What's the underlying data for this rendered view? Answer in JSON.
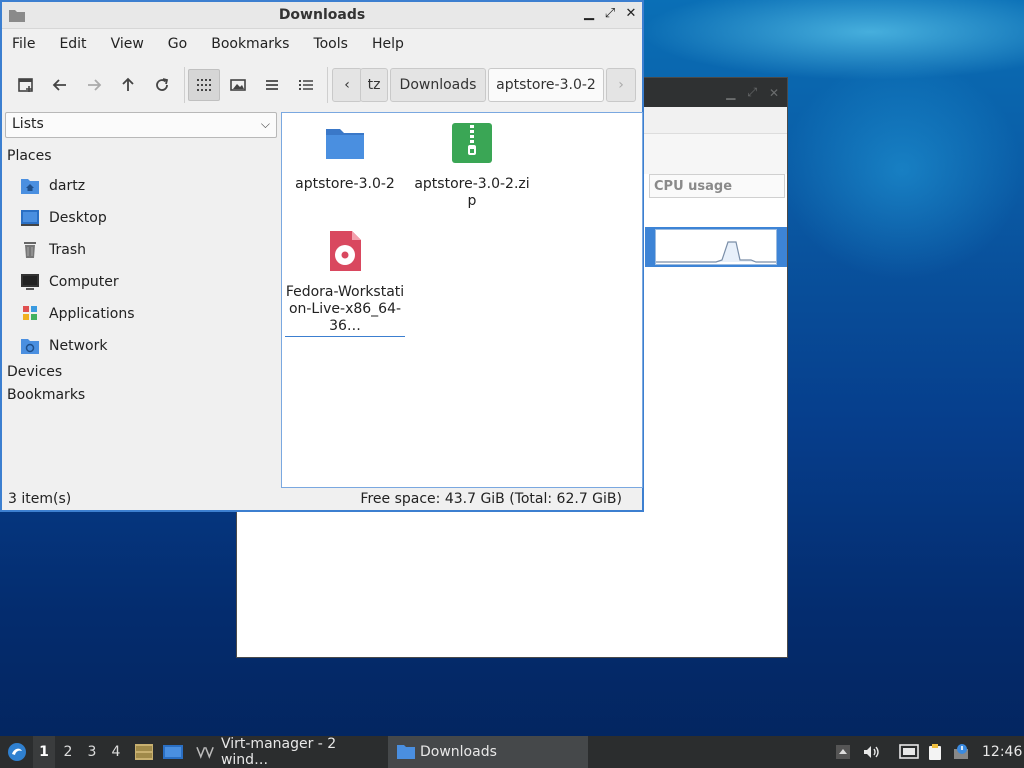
{
  "colors": {
    "accent": "#3c7fd0",
    "folder": "#4a8fe0",
    "zip": "#3aa655",
    "disc": "#d9485f",
    "taskbar": "#2b2d2e"
  },
  "background_window": {
    "column_header": "CPU usage"
  },
  "window": {
    "title": "Downloads",
    "controls": {
      "minimize": "▁",
      "maximize": "⤢",
      "close": "✕"
    }
  },
  "menubar": [
    "File",
    "Edit",
    "View",
    "Go",
    "Bookmarks",
    "Tools",
    "Help"
  ],
  "toolbar": {
    "icons": [
      "new-tab-icon",
      "back-icon",
      "forward-icon",
      "up-icon",
      "reload-icon",
      "icon-view-icon",
      "thumbnail-view-icon",
      "compact-view-icon",
      "detailed-list-icon"
    ]
  },
  "breadcrumb": {
    "left_arrow": "‹",
    "right_arrow": "›",
    "items": [
      "tz",
      "Downloads",
      "aptstore-3.0-2"
    ]
  },
  "sidebar": {
    "mode": "Lists",
    "places_label": "Places",
    "places": [
      {
        "label": "dartz",
        "icon": "home-folder-icon"
      },
      {
        "label": "Desktop",
        "icon": "desktop-icon"
      },
      {
        "label": "Trash",
        "icon": "trash-icon"
      },
      {
        "label": "Computer",
        "icon": "computer-icon"
      },
      {
        "label": "Applications",
        "icon": "applications-icon"
      },
      {
        "label": "Network",
        "icon": "network-icon"
      }
    ],
    "devices_label": "Devices",
    "bookmarks_label": "Bookmarks"
  },
  "files": [
    {
      "name": "aptstore-3.0-2",
      "icon": "folder-icon"
    },
    {
      "name": "aptstore-3.0-2.zip",
      "icon": "zip-archive-icon"
    },
    {
      "name": "Fedora-Workstation-Live-x86_64-36…",
      "icon": "disc-image-icon"
    }
  ],
  "status": {
    "count": "3 item(s)",
    "free_space": "Free space: 43.7 GiB (Total: 62.7 GiB)"
  },
  "taskbar": {
    "workspaces": [
      "1",
      "2",
      "3",
      "4"
    ],
    "tasks": [
      {
        "label": "Virt-manager - 2 wind…"
      },
      {
        "label": "Downloads"
      }
    ],
    "clock": "12:46"
  }
}
